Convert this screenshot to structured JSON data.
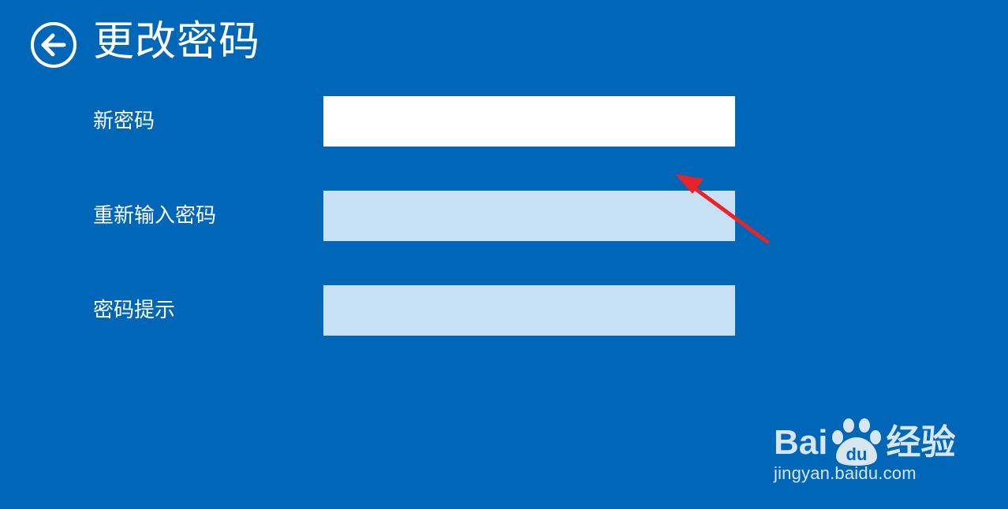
{
  "header": {
    "title": "更改密码",
    "back_icon": "back-arrow-circle-icon"
  },
  "form": {
    "fields": [
      {
        "label": "新密码",
        "value": "",
        "state": "focused"
      },
      {
        "label": "重新输入密码",
        "value": "",
        "state": "inactive"
      },
      {
        "label": "密码提示",
        "value": "",
        "state": "inactive"
      }
    ]
  },
  "annotation": {
    "icon": "red-arrow-icon",
    "color": "#e8242a"
  },
  "watermark": {
    "logo_text_left": "Bai",
    "logo_paw_text": "du",
    "logo_text_right": "经验",
    "site": "jingyan.baidu.com"
  },
  "colors": {
    "background": "#0067b8",
    "input_active": "#ffffff",
    "input_inactive": "#c8e0f3",
    "text": "#ffffff"
  }
}
